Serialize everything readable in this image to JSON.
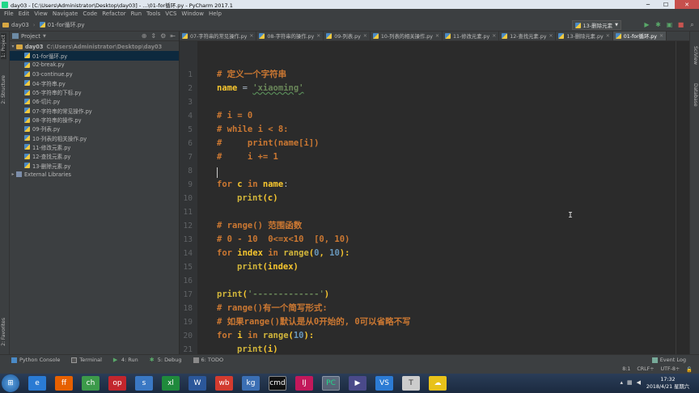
{
  "window": {
    "title": "day03 - [C:\\Users\\Administrator\\Desktop\\day03] - ...\\01-for循环.py - PyCharm 2017.1",
    "minimize": "─",
    "maximize": "☐",
    "close": "✕"
  },
  "menu": [
    "File",
    "Edit",
    "View",
    "Navigate",
    "Code",
    "Refactor",
    "Run",
    "Tools",
    "VCS",
    "Window",
    "Help"
  ],
  "breadcrumb": {
    "folder": "day03",
    "file": "01-for循环.py"
  },
  "run_config": "13-删除元素",
  "left_tabs": {
    "project": "1: Project",
    "structure": "2: Structure",
    "favorites": "2: Favorites"
  },
  "right_tabs": {
    "sciview": "SciView",
    "database": "Database"
  },
  "project_panel": {
    "label": "Project",
    "root": {
      "name": "day03",
      "path": "C:\\Users\\Administrator\\Desktop\\day03"
    },
    "files": [
      "01-for循环.py",
      "02-break.py",
      "03-continue.py",
      "04-字符串.py",
      "05-字符串的下标.py",
      "06-切片.py",
      "07-字符串的常见操作.py",
      "08-字符串的操作.py",
      "09-列表.py",
      "10-列表的相关操作.py",
      "11-修改元素.py",
      "12-查找元素.py",
      "13-删除元素.py"
    ],
    "external": "External Libraries"
  },
  "tabs": [
    "07-字符串的常见操作.py",
    "08-字符串的操作.py",
    "09-列表.py",
    "10-列表的相关操作.py",
    "11-修改元素.py",
    "12-查找元素.py",
    "13-删除元素.py",
    "01-for循环.py"
  ],
  "line_numbers": [
    "1",
    "2",
    "3",
    "4",
    "5",
    "6",
    "7",
    "8",
    "9",
    "10",
    "11",
    "12",
    "13",
    "14",
    "15",
    "16",
    "17",
    "18",
    "19",
    "20",
    "21"
  ],
  "code": {
    "l1": "# 定义一个字符串",
    "l2_var": "name",
    "l2_eq": " = ",
    "l2_str": "'xiaoming'",
    "l4": "# i = 0",
    "l5": "# while i < 8:",
    "l6": "#     print(name[i])",
    "l7": "#     i += 1",
    "l9_for": "for",
    "l9_var": " c ",
    "l9_in": "in",
    "l9_name": " name",
    "l9_colon": ":",
    "l10_print": "print",
    "l10_args": "(c)",
    "l12": "# range() 范围函数",
    "l13": "# 0 - 10  0<=x<10  [0, 10)",
    "l14_for": "for",
    "l14_var": " index ",
    "l14_in": "in",
    "l14_range": " range",
    "l14_open": "(",
    "l14_n1": "0",
    "l14_comma": ", ",
    "l14_n2": "10",
    "l14_close": "):",
    "l15_print": "print",
    "l15_args": "(index)",
    "l17_print": "print",
    "l17_open": "(",
    "l17_str": "'-------------'",
    "l17_close": ")",
    "l18": "# range()有一个简写形式:",
    "l19": "# 如果range()默认是从0开始的, 0可以省略不写",
    "l20_for": "for",
    "l20_var": " i ",
    "l20_in": "in",
    "l20_range": " range",
    "l20_open": "(",
    "l20_n": "10",
    "l20_close": "):",
    "l21_print": "print",
    "l21_args": "(i)"
  },
  "bottom_tools": [
    "Python Console",
    "Terminal",
    "4: Run",
    "5: Debug",
    "6: TODO"
  ],
  "event_log": "Event Log",
  "status": {
    "position": "8:1",
    "line_sep": "CRLF÷",
    "encoding": "UTF-8÷"
  },
  "clock": {
    "time": "17:32",
    "date": "2018/4/21 星期六"
  },
  "taskbar_apps": [
    "e",
    "ff",
    "ch",
    "op",
    "s",
    "xl",
    "W",
    "wb",
    "kg",
    "cmd",
    "IJ",
    "PC",
    "▶",
    "VS",
    "T",
    "☁"
  ]
}
